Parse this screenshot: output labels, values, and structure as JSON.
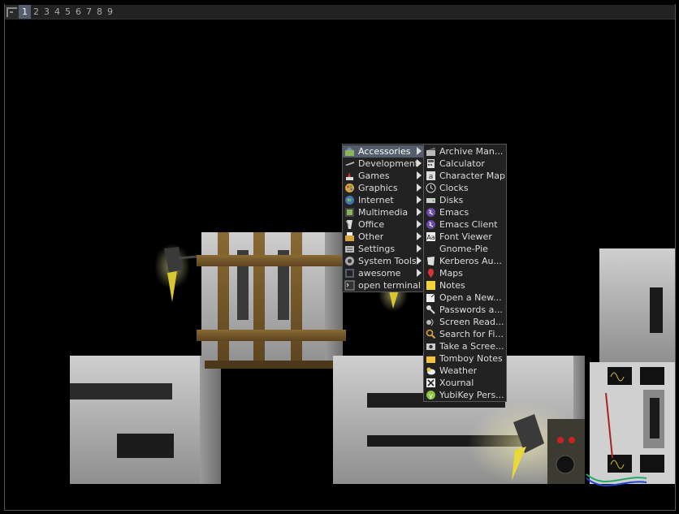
{
  "taglist": {
    "tags": [
      "1",
      "2",
      "3",
      "4",
      "5",
      "6",
      "7",
      "8",
      "9"
    ],
    "active_index": 0
  },
  "main_menu": {
    "items": [
      {
        "label": "Accessories",
        "icon": "accessories-icon",
        "has_submenu": true,
        "focused": true
      },
      {
        "label": "Development",
        "icon": "development-icon",
        "has_submenu": true
      },
      {
        "label": "Games",
        "icon": "games-icon",
        "has_submenu": true
      },
      {
        "label": "Graphics",
        "icon": "graphics-icon",
        "has_submenu": true
      },
      {
        "label": "Internet",
        "icon": "internet-icon",
        "has_submenu": true
      },
      {
        "label": "Multimedia",
        "icon": "multimedia-icon",
        "has_submenu": true
      },
      {
        "label": "Office",
        "icon": "office-icon",
        "has_submenu": true
      },
      {
        "label": "Other",
        "icon": "other-icon",
        "has_submenu": true
      },
      {
        "label": "Settings",
        "icon": "settings-icon",
        "has_submenu": true
      },
      {
        "label": "System Tools",
        "icon": "system-tools-icon",
        "has_submenu": true
      },
      {
        "label": "awesome",
        "icon": "awesome-icon",
        "has_submenu": true
      },
      {
        "label": "open terminal",
        "icon": "terminal-icon",
        "has_submenu": false
      }
    ]
  },
  "accessories_submenu": {
    "items": [
      {
        "label": "Archive Man...",
        "icon": "archive-manager-icon"
      },
      {
        "label": "Calculator",
        "icon": "calculator-icon"
      },
      {
        "label": "Character Map",
        "icon": "character-map-icon"
      },
      {
        "label": "Clocks",
        "icon": "clocks-icon"
      },
      {
        "label": "Disks",
        "icon": "disks-icon"
      },
      {
        "label": "Emacs",
        "icon": "emacs-icon"
      },
      {
        "label": "Emacs Client",
        "icon": "emacs-client-icon"
      },
      {
        "label": "Font Viewer",
        "icon": "font-viewer-icon"
      },
      {
        "label": "Gnome-Pie",
        "icon": ""
      },
      {
        "label": "Kerberos Au...",
        "icon": "kerberos-icon"
      },
      {
        "label": "Maps",
        "icon": "maps-icon"
      },
      {
        "label": "Notes",
        "icon": "notes-icon"
      },
      {
        "label": "Open a New...",
        "icon": "open-new-icon"
      },
      {
        "label": "Passwords a...",
        "icon": "passwords-icon"
      },
      {
        "label": "Screen Read...",
        "icon": "screen-reader-icon"
      },
      {
        "label": "Search for Fi...",
        "icon": "search-files-icon"
      },
      {
        "label": "Take a Scree...",
        "icon": "screenshot-icon"
      },
      {
        "label": "Tomboy Notes",
        "icon": "tomboy-notes-icon"
      },
      {
        "label": "Weather",
        "icon": "weather-icon"
      },
      {
        "label": "Xournal",
        "icon": "xournal-icon"
      },
      {
        "label": "YubiKey Pers...",
        "icon": "yubikey-icon"
      }
    ]
  },
  "colors": {
    "bar_bg": "#222222",
    "focus_bg": "#535d6c",
    "menu_border": "#555555",
    "desktop_bg": "#000000"
  }
}
